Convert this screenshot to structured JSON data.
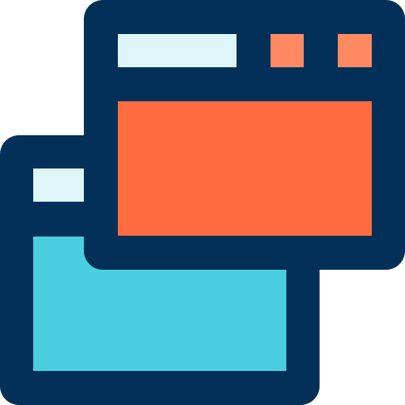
{
  "icon": {
    "name": "multiple-windows-icon",
    "colors": {
      "outline": "#033058",
      "back_window_content": "#4ACFE0",
      "front_window_content": "#FF6C41",
      "title_bar": "#DFF6F8",
      "control_buttons": "#FF8A62",
      "background": "#FFFFFF"
    }
  }
}
